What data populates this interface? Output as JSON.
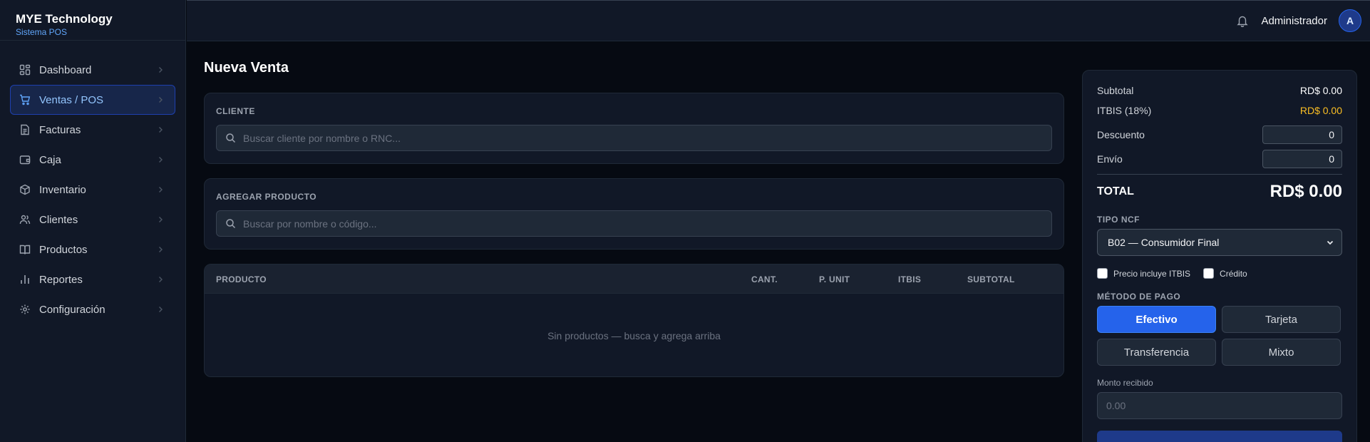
{
  "brand": {
    "title": "MYE Technology",
    "subtitle": "Sistema POS"
  },
  "sidebar": {
    "items": [
      {
        "label": "Dashboard",
        "icon": "dashboard-icon"
      },
      {
        "label": "Ventas / POS",
        "icon": "cart-icon",
        "active": true
      },
      {
        "label": "Facturas",
        "icon": "file-icon"
      },
      {
        "label": "Caja",
        "icon": "wallet-icon"
      },
      {
        "label": "Inventario",
        "icon": "box-icon"
      },
      {
        "label": "Clientes",
        "icon": "users-icon"
      },
      {
        "label": "Productos",
        "icon": "book-icon"
      },
      {
        "label": "Reportes",
        "icon": "bar-chart-icon"
      },
      {
        "label": "Configuración",
        "icon": "gear-icon"
      }
    ]
  },
  "topbar": {
    "user_name": "Administrador",
    "avatar_initial": "A"
  },
  "main": {
    "title": "Nueva Venta",
    "cliente": {
      "label": "CLIENTE",
      "placeholder": "Buscar cliente por nombre o RNC..."
    },
    "producto": {
      "label": "AGREGAR PRODUCTO",
      "placeholder": "Buscar por nombre o código..."
    },
    "table": {
      "columns": [
        "PRODUCTO",
        "CANT.",
        "P. UNIT",
        "ITBIS",
        "SUBTOTAL"
      ],
      "empty_message": "Sin productos — busca y agrega arriba"
    }
  },
  "summary": {
    "subtotal_label": "Subtotal",
    "subtotal_value": "RD$ 0.00",
    "itbis_label": "ITBIS (18%)",
    "itbis_value": "RD$ 0.00",
    "descuento_label": "Descuento",
    "descuento_value": "0",
    "envio_label": "Envío",
    "envio_value": "0",
    "total_label": "TOTAL",
    "total_value": "RD$ 0.00",
    "ncf_label": "TIPO NCF",
    "ncf_selected": "B02 — Consumidor Final",
    "check_itbis_label": "Precio incluye ITBIS",
    "check_credito_label": "Crédito",
    "payment_label": "MÉTODO DE PAGO",
    "payment_methods": [
      "Efectivo",
      "Tarjeta",
      "Transferencia",
      "Mixto"
    ],
    "payment_selected": "Efectivo",
    "monto_label": "Monto recibido",
    "monto_placeholder": "0.00"
  },
  "colors": {
    "accent": "#2563eb",
    "background": "#060a12",
    "panel": "#111827",
    "itbis": "#fbbf24"
  }
}
